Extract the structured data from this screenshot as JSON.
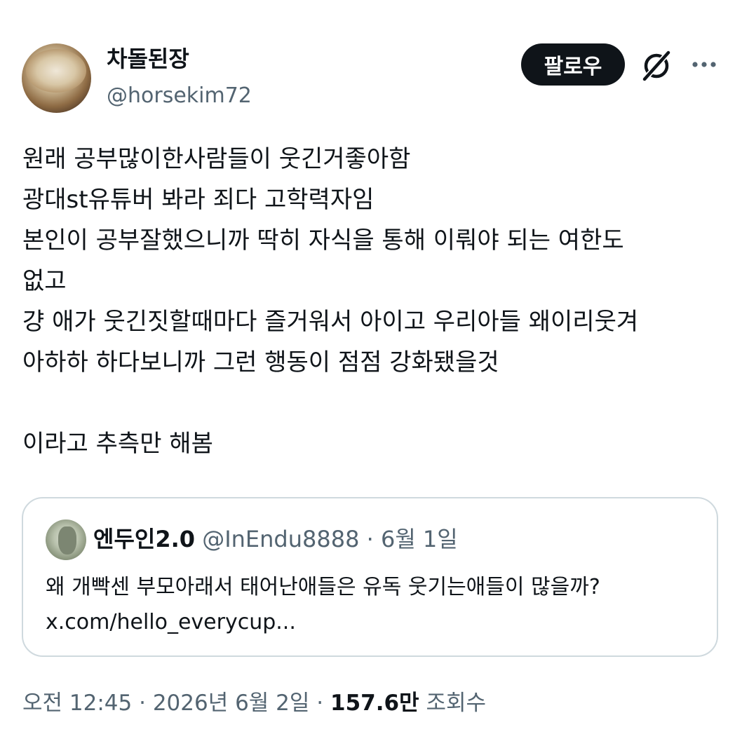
{
  "author": {
    "display_name": "차돌된장",
    "handle": "@horsekim72"
  },
  "actions": {
    "follow_label": "팔로우",
    "grok_icon": "grok-icon",
    "more_icon": "more-icon"
  },
  "tweet": {
    "lines": [
      "원래 공부많이한사람들이 웃긴거좋아함",
      "광대st유튜버 봐라 죄다 고학력자임",
      "본인이 공부잘했으니까 딱히 자식을 통해 이뤄야 되는 여한도",
      "없고",
      "걍 애가 웃긴짓할때마다 즐거워서 아이고 우리아들 왜이리웃겨",
      "아하하 하다보니까 그런 행동이 점점 강화됐을것",
      "",
      "이라고 추측만 해봄"
    ]
  },
  "quote": {
    "display_name": "엔두인2.0",
    "handle": "@InEndu8888",
    "separator": "·",
    "date": "6월 1일",
    "lines": [
      "왜 개빡센 부모아래서 태어난애들은 유독 웃기는애들이 많을까?",
      "x.com/hello_everycup..."
    ]
  },
  "footer": {
    "time": "오전 12:45",
    "separator": "·",
    "date": "2026년 6월 2일",
    "views_count": "157.6만",
    "views_label": "조회수"
  },
  "colors": {
    "text_primary": "#0f1419",
    "text_secondary": "#536471",
    "border": "#cfd9de",
    "button_bg": "#0f1419"
  }
}
